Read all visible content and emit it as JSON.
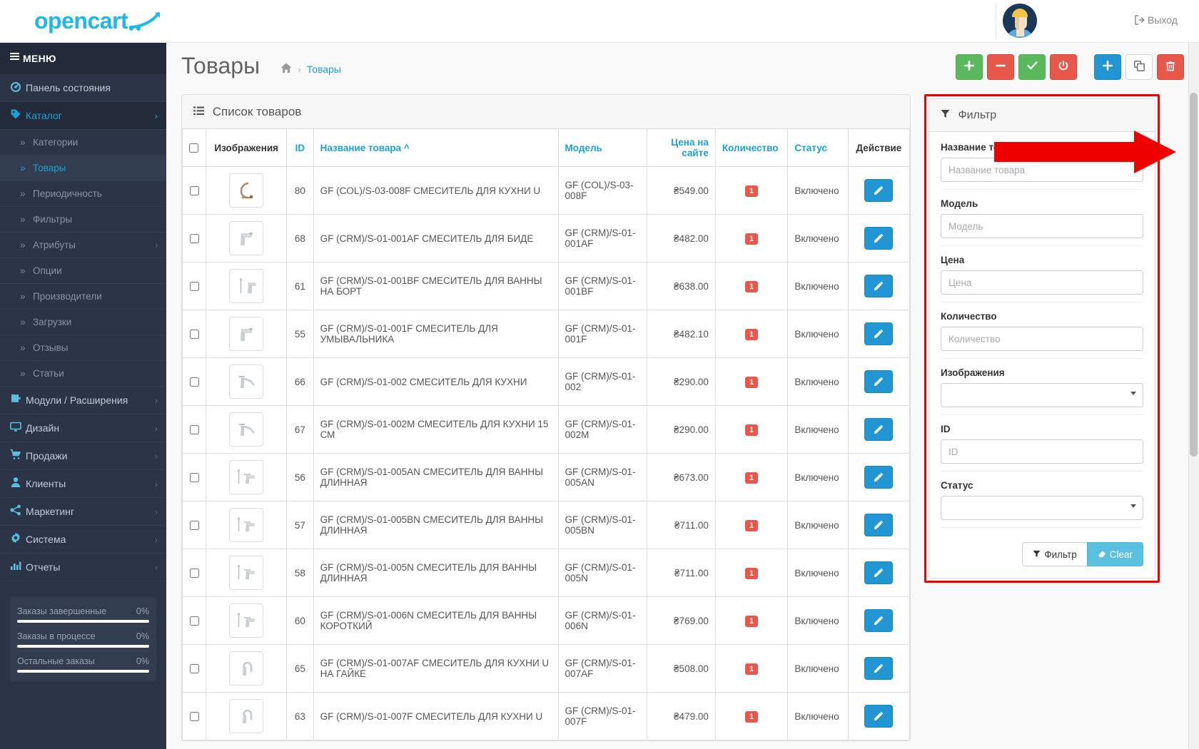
{
  "brand": {
    "name": "opencart",
    "color": "#20b5eb"
  },
  "topbar": {
    "logout_label": "Выход",
    "logout_icon": "sign-out-icon",
    "avatar_name": "user-avatar"
  },
  "sidebar": {
    "menu_label": "МЕНЮ",
    "items": [
      {
        "label": "Панель состояния",
        "icon": "dashboard-icon",
        "has_caret": false,
        "active": false
      },
      {
        "label": "Каталог",
        "icon": "tag-icon",
        "has_caret": true,
        "active": true
      },
      {
        "label": "Модули / Расширения",
        "icon": "puzzle-icon",
        "has_caret": true,
        "active": false
      },
      {
        "label": "Дизайн",
        "icon": "desktop-icon",
        "has_caret": true,
        "active": false
      },
      {
        "label": "Продажи",
        "icon": "cart-icon",
        "has_caret": true,
        "active": false
      },
      {
        "label": "Клиенты",
        "icon": "user-icon",
        "has_caret": true,
        "active": false
      },
      {
        "label": "Маркетинг",
        "icon": "share-icon",
        "has_caret": true,
        "active": false
      },
      {
        "label": "Система",
        "icon": "gear-icon",
        "has_caret": true,
        "active": false
      },
      {
        "label": "Отчеты",
        "icon": "bar-chart-icon",
        "has_caret": true,
        "active": false
      }
    ],
    "catalog_subitems": [
      {
        "label": "Категории",
        "has_caret": false,
        "selected": false
      },
      {
        "label": "Товары",
        "has_caret": false,
        "selected": true
      },
      {
        "label": "Периодичность",
        "has_caret": false,
        "selected": false
      },
      {
        "label": "Фильтры",
        "has_caret": false,
        "selected": false
      },
      {
        "label": "Атрибуты",
        "has_caret": true,
        "selected": false
      },
      {
        "label": "Опции",
        "has_caret": false,
        "selected": false
      },
      {
        "label": "Производители",
        "has_caret": false,
        "selected": false
      },
      {
        "label": "Загрузки",
        "has_caret": false,
        "selected": false
      },
      {
        "label": "Отзывы",
        "has_caret": false,
        "selected": false
      },
      {
        "label": "Статьи",
        "has_caret": false,
        "selected": false
      }
    ],
    "stats": [
      {
        "label": "Заказы завершенные",
        "value": "0%",
        "percent": 100
      },
      {
        "label": "Заказы в процессе",
        "value": "0%",
        "percent": 100
      },
      {
        "label": "Остальные заказы",
        "value": "0%",
        "percent": 100
      }
    ]
  },
  "page": {
    "title": "Товары",
    "breadcrumb_home_icon": "home-icon",
    "breadcrumb_separator": "›",
    "breadcrumb_current": "Товары"
  },
  "toolbar": {
    "buttons": [
      {
        "name": "add-to-store-button",
        "icon": "plus-icon",
        "style": "green",
        "glyph": "＋"
      },
      {
        "name": "remove-from-store-button",
        "icon": "minus-icon",
        "style": "red",
        "glyph": "−"
      },
      {
        "name": "enable-button",
        "icon": "check-icon",
        "style": "green",
        "glyph": "✔"
      },
      {
        "name": "disable-button",
        "icon": "power-icon",
        "style": "red",
        "glyph": "⏻"
      },
      {
        "name": "add-new-button",
        "icon": "plus-icon",
        "style": "blue",
        "glyph": "＋",
        "gap": true
      },
      {
        "name": "copy-button",
        "icon": "copy-icon",
        "style": "white",
        "glyph": "❏"
      },
      {
        "name": "delete-button",
        "icon": "trash-icon",
        "style": "red",
        "glyph": "🗑"
      }
    ]
  },
  "list": {
    "header_title": "Список товаров",
    "header_icon": "list-icon",
    "columns": [
      {
        "key": "check",
        "label": "",
        "accent": false
      },
      {
        "key": "image",
        "label": "Изображения",
        "accent": false
      },
      {
        "key": "id",
        "label": "ID",
        "accent": true
      },
      {
        "key": "name",
        "label": "Название товара ^",
        "accent": true
      },
      {
        "key": "model",
        "label": "Модель",
        "accent": true
      },
      {
        "key": "price",
        "label": "Цена на сайте",
        "accent": true
      },
      {
        "key": "qty",
        "label": "Количество",
        "accent": true
      },
      {
        "key": "status",
        "label": "Статус",
        "accent": true
      },
      {
        "key": "action",
        "label": "Действие",
        "accent": false
      }
    ],
    "rows": [
      {
        "id": "80",
        "name": "GF (COL)/S-03-008F СМЕСИТЕЛЬ ДЛЯ КУХНИ U",
        "model": "GF (COL)/S-03-008F",
        "price": "₴549.00",
        "qty": "1",
        "status": "Включено",
        "thumb": "faucet-arch-bronze"
      },
      {
        "id": "68",
        "name": "GF (CRM)/S-01-001AF СМЕСИТЕЛЬ ДЛЯ БИДЕ",
        "model": "GF (CRM)/S-01-001AF",
        "price": "₴482.00",
        "qty": "1",
        "status": "Включено",
        "thumb": "faucet-basin"
      },
      {
        "id": "61",
        "name": "GF (CRM)/S-01-001BF СМЕСИТЕЛЬ ДЛЯ ВАННЫ НА БОРТ",
        "model": "GF (CRM)/S-01-001BF",
        "price": "₴638.00",
        "qty": "1",
        "status": "Включено",
        "thumb": "faucet-shower-set"
      },
      {
        "id": "55",
        "name": "GF (CRM)/S-01-001F СМЕСИТЕЛЬ ДЛЯ УМЫВАЛЬНИКА",
        "model": "GF (CRM)/S-01-001F",
        "price": "₴482.10",
        "qty": "1",
        "status": "Включено",
        "thumb": "faucet-basin"
      },
      {
        "id": "66",
        "name": "GF (CRM)/S-01-002 СМЕСИТЕЛЬ ДЛЯ КУХНИ",
        "model": "GF (CRM)/S-01-002",
        "price": "₴290.00",
        "qty": "1",
        "status": "Включено",
        "thumb": "faucet-kitchen"
      },
      {
        "id": "67",
        "name": "GF (CRM)/S-01-002M СМЕСИТЕЛЬ ДЛЯ КУХНИ 15 СМ",
        "model": "GF (CRM)/S-01-002M",
        "price": "₴290.00",
        "qty": "1",
        "status": "Включено",
        "thumb": "faucet-kitchen"
      },
      {
        "id": "56",
        "name": "GF (CRM)/S-01-005AN СМЕСИТЕЛЬ ДЛЯ ВАННЫ ДЛИННАЯ",
        "model": "GF (CRM)/S-01-005AN",
        "price": "₴673.00",
        "qty": "1",
        "status": "Включено",
        "thumb": "faucet-bath-long"
      },
      {
        "id": "57",
        "name": "GF (CRM)/S-01-005BN СМЕСИТЕЛЬ ДЛЯ ВАННЫ ДЛИННАЯ",
        "model": "GF (CRM)/S-01-005BN",
        "price": "₴711.00",
        "qty": "1",
        "status": "Включено",
        "thumb": "faucet-bath-long"
      },
      {
        "id": "58",
        "name": "GF (CRM)/S-01-005N СМЕСИТЕЛЬ ДЛЯ ВАННЫ ДЛИННАЯ",
        "model": "GF (CRM)/S-01-005N",
        "price": "₴711.00",
        "qty": "1",
        "status": "Включено",
        "thumb": "faucet-bath-long"
      },
      {
        "id": "60",
        "name": "GF (CRM)/S-01-006N СМЕСИТЕЛЬ ДЛЯ ВАННЫ КОРОТКИЙ",
        "model": "GF (CRM)/S-01-006N",
        "price": "₴769.00",
        "qty": "1",
        "status": "Включено",
        "thumb": "faucet-bath-long"
      },
      {
        "id": "65",
        "name": "GF (CRM)/S-01-007AF СМЕСИТЕЛЬ ДЛЯ КУХНИ U НА ГАЙКЕ",
        "model": "GF (CRM)/S-01-007AF",
        "price": "₴508.00",
        "qty": "1",
        "status": "Включено",
        "thumb": "faucet-u-kitchen"
      },
      {
        "id": "63",
        "name": "GF (CRM)/S-01-007F СМЕСИТЕЛЬ ДЛЯ КУХНИ U",
        "model": "GF (CRM)/S-01-007F",
        "price": "₴479.00",
        "qty": "1",
        "status": "Включено",
        "thumb": "faucet-u-kitchen"
      }
    ],
    "edit_icon": "pencil-icon"
  },
  "filter": {
    "title": "Фильтр",
    "title_icon": "funnel-icon",
    "fields": [
      {
        "name": "product-name",
        "label": "Название товара",
        "type": "text",
        "value": "",
        "placeholder": "Название товара"
      },
      {
        "name": "model",
        "label": "Модель",
        "type": "text",
        "value": "",
        "placeholder": "Модель"
      },
      {
        "name": "price",
        "label": "Цена",
        "type": "text",
        "value": "",
        "placeholder": "Цена"
      },
      {
        "name": "quantity",
        "label": "Количество",
        "type": "text",
        "value": "",
        "placeholder": "Количество"
      },
      {
        "name": "images",
        "label": "Изображения",
        "type": "select",
        "value": "",
        "placeholder": ""
      },
      {
        "name": "id",
        "label": "ID",
        "type": "text",
        "value": "",
        "placeholder": "ID"
      },
      {
        "name": "status",
        "label": "Статус",
        "type": "select",
        "value": "",
        "placeholder": ""
      }
    ],
    "apply_label": "Фильтр",
    "apply_icon": "funnel-icon",
    "clear_label": "Clear",
    "clear_icon": "eraser-icon"
  },
  "annotation": {
    "arrow_color": "#ee0000",
    "highlight_color": "#ee0000"
  }
}
